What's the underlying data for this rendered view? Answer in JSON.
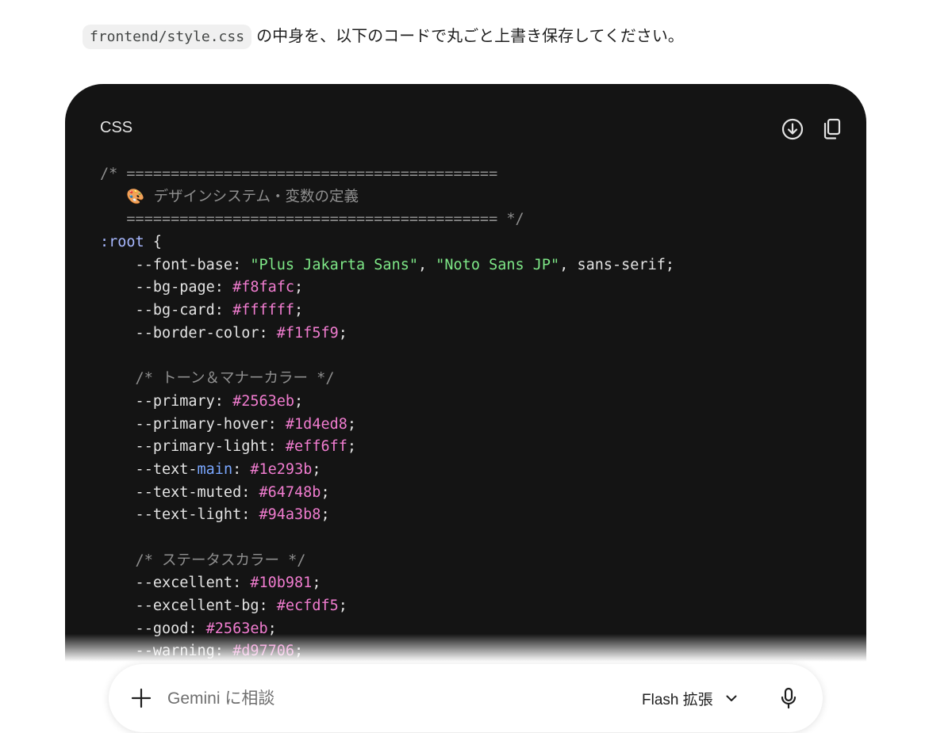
{
  "message": {
    "filename": "frontend/style.css",
    "text": "の中身を、以下のコードで丸ごと上書き保存してください。"
  },
  "code_block": {
    "language": "CSS",
    "lines": [
      [
        {
          "t": "/* ==========================================",
          "k": "c"
        }
      ],
      [
        {
          "t": "   🎨 デザインシステム・変数の定義",
          "k": "c"
        }
      ],
      [
        {
          "t": "   ========================================== */",
          "k": "c"
        }
      ],
      [
        {
          "t": ":root",
          "k": "sel"
        },
        {
          "t": " {",
          "k": ""
        }
      ],
      [
        {
          "t": "    --font-base: ",
          "k": ""
        },
        {
          "t": "\"Plus Jakarta Sans\"",
          "k": "s"
        },
        {
          "t": ", ",
          "k": ""
        },
        {
          "t": "\"Noto Sans JP\"",
          "k": "s"
        },
        {
          "t": ", sans-serif;",
          "k": ""
        }
      ],
      [
        {
          "t": "    --bg-page: ",
          "k": ""
        },
        {
          "t": "#f8fafc",
          "k": "h"
        },
        {
          "t": ";",
          "k": ""
        }
      ],
      [
        {
          "t": "    --bg-card: ",
          "k": ""
        },
        {
          "t": "#ffffff",
          "k": "h"
        },
        {
          "t": ";",
          "k": ""
        }
      ],
      [
        {
          "t": "    --border-color: ",
          "k": ""
        },
        {
          "t": "#f1f5f9",
          "k": "h"
        },
        {
          "t": ";",
          "k": ""
        }
      ],
      [
        {
          "t": "",
          "k": ""
        }
      ],
      [
        {
          "t": "    /* トーン＆マナーカラー */",
          "k": "c"
        }
      ],
      [
        {
          "t": "    --primary: ",
          "k": ""
        },
        {
          "t": "#2563eb",
          "k": "h"
        },
        {
          "t": ";",
          "k": ""
        }
      ],
      [
        {
          "t": "    --primary-hover: ",
          "k": ""
        },
        {
          "t": "#1d4ed8",
          "k": "h"
        },
        {
          "t": ";",
          "k": ""
        }
      ],
      [
        {
          "t": "    --primary-light: ",
          "k": ""
        },
        {
          "t": "#eff6ff",
          "k": "h"
        },
        {
          "t": ";",
          "k": ""
        }
      ],
      [
        {
          "t": "    --text-",
          "k": ""
        },
        {
          "t": "main",
          "k": "kw"
        },
        {
          "t": ": ",
          "k": ""
        },
        {
          "t": "#1e293b",
          "k": "h"
        },
        {
          "t": ";",
          "k": ""
        }
      ],
      [
        {
          "t": "    --text-muted: ",
          "k": ""
        },
        {
          "t": "#64748b",
          "k": "h"
        },
        {
          "t": ";",
          "k": ""
        }
      ],
      [
        {
          "t": "    --text-light: ",
          "k": ""
        },
        {
          "t": "#94a3b8",
          "k": "h"
        },
        {
          "t": ";",
          "k": ""
        }
      ],
      [
        {
          "t": "",
          "k": ""
        }
      ],
      [
        {
          "t": "    /* ステータスカラー */",
          "k": "c"
        }
      ],
      [
        {
          "t": "    --excellent: ",
          "k": ""
        },
        {
          "t": "#10b981",
          "k": "h"
        },
        {
          "t": ";",
          "k": ""
        }
      ],
      [
        {
          "t": "    --excellent-bg: ",
          "k": ""
        },
        {
          "t": "#ecfdf5",
          "k": "h"
        },
        {
          "t": ";",
          "k": ""
        }
      ],
      [
        {
          "t": "    --good: ",
          "k": ""
        },
        {
          "t": "#2563eb",
          "k": "h"
        },
        {
          "t": ";",
          "k": ""
        }
      ],
      [
        {
          "t": "    --warning: ",
          "k": ""
        },
        {
          "t": "#d97706",
          "k": "h"
        },
        {
          "t": ";",
          "k": ""
        }
      ]
    ],
    "download_icon": "download-icon",
    "copy_icon": "copy-icon"
  },
  "prompt_bar": {
    "placeholder": "Gemini に相談",
    "model_label": "Flash 拡張",
    "add_icon": "plus-icon",
    "model_icon": "chevron-down-icon",
    "mic_icon": "mic-icon"
  },
  "colors": {
    "code_bg": "#141414",
    "comment": "#8f8f8f",
    "string": "#7ee787",
    "hex": "#f07ccf"
  }
}
